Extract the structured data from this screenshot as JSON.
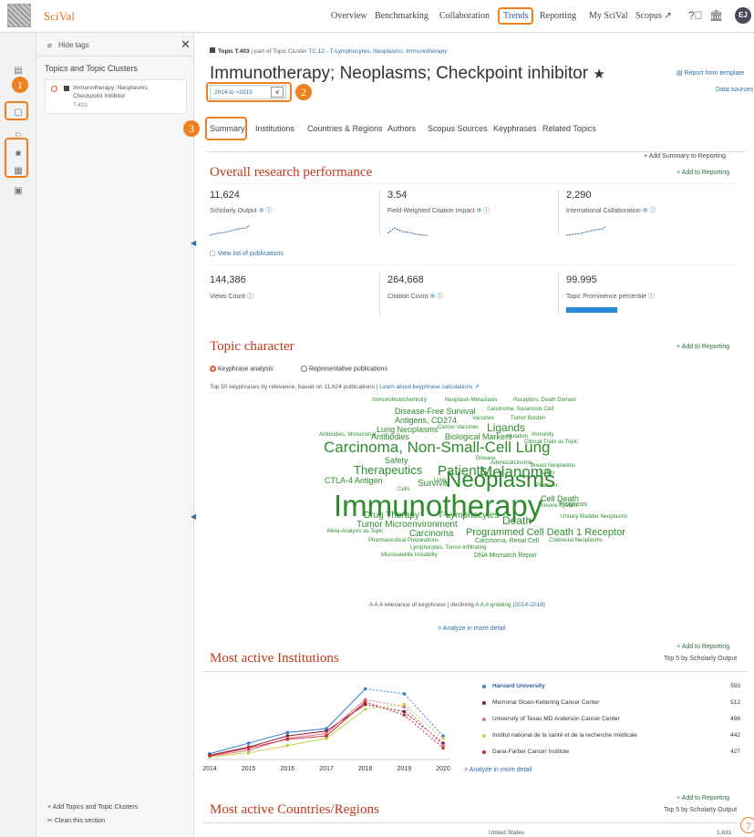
{
  "app": {
    "name": "SciVal",
    "avatar": "EJ"
  },
  "nav": {
    "overview": "Overview",
    "benchmarking": "Benchmarking",
    "collaboration": "Collaboration",
    "trends": "Trends",
    "reporting": "Reporting",
    "my_scival": "My SciVal",
    "scopus": "Scopus ↗"
  },
  "panel": {
    "hide_tags": "Hide tags",
    "section_title": "Topics and Topic Clusters",
    "topic_name": "Immunotherapy; Neoplasms; Checkpoint Inhibitor",
    "topic_id": "T.403",
    "add_topics": "+ Add Topics and Topic Clusters",
    "clean": "Clean this section"
  },
  "annotations": {
    "n1": "1",
    "n2": "2",
    "n3": "3",
    "n7": "7"
  },
  "header": {
    "topic_label": "Topic T.403",
    "part_of": "| part of Topic Cluster",
    "cluster": "TC.12 - T-Lymphocytes; Neoplasms; Immunotherapy",
    "title": "Immunotherapy; Neoplasms; Checkpoint inhibitor",
    "star": "★",
    "years": "2014 to >2019",
    "report": "Report from template",
    "data_sources": "Data sources"
  },
  "tabs": [
    "Summary",
    "Institutions",
    "Countries & Regions",
    "Authors",
    "Scopus Sources",
    "Keyphrases",
    "Related Topics"
  ],
  "overall": {
    "add_summary": "+ Add Summary to Reporting",
    "add": "+ Add to Reporting",
    "title": "Overall research performance",
    "metrics": [
      {
        "value": "11,624",
        "label": "Scholarly Output"
      },
      {
        "value": "3.54",
        "label": "Field-Weighted Citation Impact"
      },
      {
        "value": "2,290",
        "label": "International Collaboration"
      },
      {
        "value": "144,386",
        "label": "Views Count"
      },
      {
        "value": "264,668",
        "label": "Citation Count"
      },
      {
        "value": "99.995",
        "label": "Topic Prominence percentile"
      }
    ],
    "prominence_fill": 0.99995,
    "view_list": "View list of publications"
  },
  "character": {
    "title": "Topic character",
    "add": "+ Add to Reporting",
    "opt1": "Keyphrase analysis",
    "opt2": "Representative publications",
    "note": "Top 50 keyphrases by relevance, based on 11,624 publications",
    "learn": "| Learn about keyphrase calculations ↗",
    "legend_a": "A A A relevance of keyphrase |",
    "legend_b": "declining",
    "legend_c": "A A A growing",
    "legend_d": "(2014-2018)",
    "analyze": "> Analyze in more detail",
    "words": [
      "Immunohistochemistry",
      "Neoplasm Metastasis",
      "Receptors, Death Domain",
      "Disease-Free Survival",
      "Carcinoma, Squamous Cell",
      "Antigens, CD274",
      "Vaccines",
      "Tumor Burden",
      "Lung Neoplasms",
      "Cancer Vaccines",
      "Ligands",
      "Antibodies, Monoclonal",
      "Antibodies",
      "Biological Markers",
      "Mutation",
      "Immunity",
      "Clinical Trials as Topic",
      "Carcinoma, Non-Small-Cell Lung",
      "Safety",
      "Disease",
      "Adenocarcinoma",
      "Breast Neoplasms",
      "Therapeutics",
      "Patients",
      "Melanoma",
      "Colitis",
      "CTLA-4 Antigen",
      "Lung",
      "Survival",
      "Neoplasms",
      "Cells",
      "Platinum",
      "Immunotherapy",
      "Cell Death",
      "Prognosis",
      "Immune System",
      "Drug Therapy",
      "T-Lymphocytes",
      "Death",
      "Urinary Bladder Neoplasms",
      "Tumor Microenvironment",
      "Meta-Analysis as Topic",
      "Carcinoma",
      "Programmed Cell Death 1 Receptor",
      "Pharmaceutical Preparations",
      "Carcinoma, Renal Cell",
      "Colorectal Neoplasms",
      "Lymphocytes, Tumor-Infiltrating",
      "Microsatellite Instability",
      "DNA Mismatch Repair"
    ]
  },
  "institutions": {
    "title": "Most active Institutions",
    "add": "+ Add to Reporting",
    "top": "Top 5 by Scholarly Output",
    "analyze": "> Analyze in more detail",
    "list": [
      {
        "name": "Harvard University",
        "value": "593",
        "color": "#3a7bd5"
      },
      {
        "name": "Memorial Sloan-Kettering Cancer Center",
        "value": "512",
        "color": "#8b1a3a"
      },
      {
        "name": "University of Texas MD Anderson Cancer Center",
        "value": "496",
        "color": "#e86a8a"
      },
      {
        "name": "Institut national de la santé et de la recherche médicale",
        "value": "442",
        "color": "#c8d04a"
      },
      {
        "name": "Dana-Farber Cancer Institute",
        "value": "427",
        "color": "#d03030"
      }
    ]
  },
  "chart_data": {
    "type": "line",
    "x": [
      "2014",
      "2015",
      "2016",
      "2017",
      "2018",
      "2019",
      "2020"
    ],
    "series": [
      {
        "name": "Harvard University",
        "values": [
          8,
          30,
          52,
          60,
          142,
          132,
          45
        ]
      },
      {
        "name": "Memorial Sloan-Kettering Cancer Center",
        "values": [
          5,
          22,
          45,
          55,
          110,
          95,
          30
        ]
      },
      {
        "name": "University of Texas MD Anderson Cancer Center",
        "values": [
          3,
          15,
          40,
          50,
          120,
          105,
          25
        ]
      },
      {
        "name": "Institut national de la santé et de la recherche médicale",
        "values": [
          2,
          10,
          25,
          40,
          100,
          110,
          40
        ]
      },
      {
        "name": "Dana-Farber Cancer Institute",
        "values": [
          4,
          20,
          38,
          45,
          115,
          88,
          20
        ]
      }
    ],
    "ylim": [
      0,
      160
    ]
  },
  "countries": {
    "title": "Most active Countries/Regions",
    "add": "+ Add to Reporting",
    "top": "Top 5 by Scholarly Output",
    "first": "United States",
    "first_val": "1,631"
  }
}
